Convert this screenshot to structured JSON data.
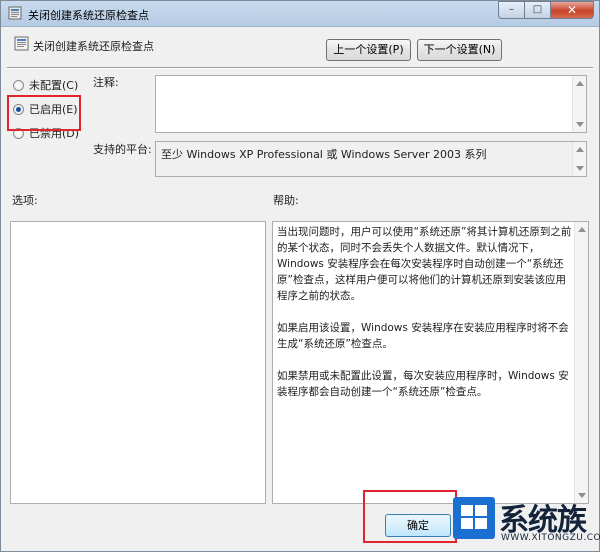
{
  "window": {
    "title": "关闭创建系统还原检查点",
    "buttons": {
      "minimize": "–",
      "maximize": "□",
      "close": "✕"
    }
  },
  "header": {
    "title": "关闭创建系统还原检查点",
    "prev_label": "上一个设置(P)",
    "next_label": "下一个设置(N)"
  },
  "state": {
    "options": [
      {
        "label": "未配置(C)",
        "checked": false
      },
      {
        "label": "已启用(E)",
        "checked": true
      },
      {
        "label": "已禁用(D)",
        "checked": false
      }
    ]
  },
  "fields": {
    "comment_label": "注释:",
    "comment_value": "",
    "platform_label": "支持的平台:",
    "platform_value": "至少 Windows XP Professional 或 Windows Server 2003 系列"
  },
  "sections": {
    "options_label": "选项:",
    "help_label": "帮助:"
  },
  "help": {
    "paragraphs": [
      "当出现问题时，用户可以使用“系统还原”将其计算机还原到之前的某个状态，同时不会丢失个人数据文件。默认情况下，Windows 安装程序会在每次安装程序时自动创建一个“系统还原”检查点，这样用户便可以将他们的计算机还原到安装该应用程序之前的状态。",
      "如果启用该设置，Windows 安装程序在安装应用程序时将不会生成“系统还原”检查点。",
      "如果禁用或未配置此设置，每次安装应用程序时，Windows 安装程序都会自动创建一个“系统还原”检查点。"
    ]
  },
  "footer": {
    "ok_label": "确定"
  },
  "watermark": {
    "brand": "系统族",
    "url": "WWW.XITONGZU.COM"
  },
  "colors": {
    "highlight_box": "#e0262c",
    "radio_dot": "#1d4f9c"
  }
}
